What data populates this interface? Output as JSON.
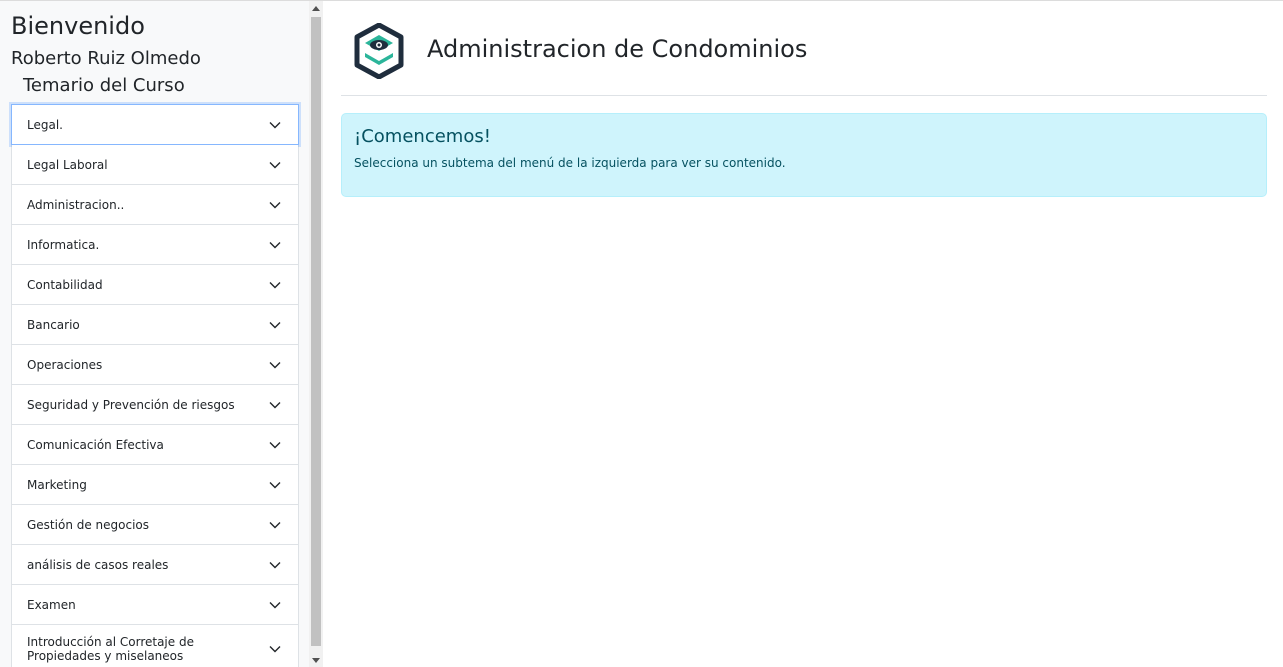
{
  "sidebar": {
    "welcome": "Bienvenido",
    "user_name": "Roberto Ruiz Olmedo",
    "course_title": "Temario del Curso",
    "items": [
      {
        "label": "Legal."
      },
      {
        "label": "Legal Laboral"
      },
      {
        "label": "Administracion.."
      },
      {
        "label": "Informatica."
      },
      {
        "label": "Contabilidad"
      },
      {
        "label": "Bancario"
      },
      {
        "label": "Operaciones"
      },
      {
        "label": "Seguridad y Prevención de riesgos"
      },
      {
        "label": "Comunicación Efectiva"
      },
      {
        "label": "Marketing"
      },
      {
        "label": "Gestión de negocios"
      },
      {
        "label": "análisis de casos reales"
      },
      {
        "label": "Examen"
      },
      {
        "label": "Introducción al Corretaje de Propiedades y miselaneos"
      }
    ]
  },
  "header": {
    "title": "Administracion de Condominios",
    "logo_icon": "condo-logo-icon"
  },
  "alert": {
    "heading": "¡Comencemos!",
    "text": "Selecciona un subtema del menú de la izquierda para ver su contenido."
  },
  "colors": {
    "alert_bg": "#cff4fc",
    "alert_text": "#055160",
    "logo_dark": "#1f2d3d",
    "logo_teal": "#2bb59a"
  }
}
